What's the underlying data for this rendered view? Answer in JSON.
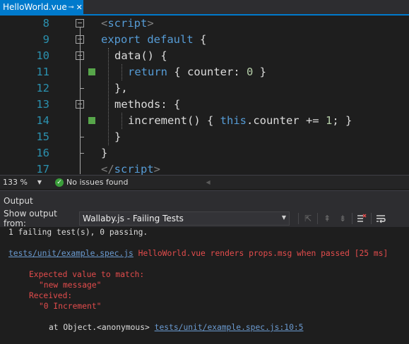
{
  "tab": {
    "title": "HelloWorld.vue",
    "pin_icon": "pin-icon",
    "close_icon": "close-icon"
  },
  "editor": {
    "line_numbers": [
      "8",
      "9",
      "10",
      "11",
      "12",
      "13",
      "14",
      "15",
      "16",
      "17"
    ],
    "lines": {
      "l8_open": "<",
      "l8_tag": "script",
      "l8_close": ">",
      "l9_kw": "export default",
      "l9_rest": " {",
      "l10": "data() {",
      "l11_kw": "return",
      "l11_a": " { counter: ",
      "l11_num": "0",
      "l11_b": " }",
      "l12": "},",
      "l13": "methods: {",
      "l14_a": "increment() { ",
      "l14_kw": "this",
      "l14_b": ".counter += ",
      "l14_num": "1",
      "l14_c": "; }",
      "l15": "}",
      "l16": "}",
      "l17_open": "</",
      "l17_tag": "script",
      "l17_close": ">"
    }
  },
  "statusbar": {
    "zoom": "133 %",
    "issues": "No issues found"
  },
  "output": {
    "title": "Output",
    "show_from_label": "Show output from:",
    "source": "Wallaby.js - Failing Tests",
    "lines": {
      "summary": "1 failing test(s), 0 passing.",
      "test_file": "tests/unit/example.spec.js",
      "test_desc": " HelloWorld.vue renders props.msg when passed [25 ms]",
      "expected_label": "Expected value to match:",
      "expected_value": "\"new message\"",
      "received_label": "Received:",
      "received_value": "\"0 Increment\"",
      "at_prefix": "at Object.<anonymous> ",
      "at_link": "tests/unit/example.spec.js:10:5"
    }
  },
  "colors": {
    "accent": "#007acc",
    "keyword": "#569cd6",
    "number": "#b5cea8",
    "error": "#e34c4c",
    "link": "#6b9bd1",
    "marker": "#57a64a"
  }
}
